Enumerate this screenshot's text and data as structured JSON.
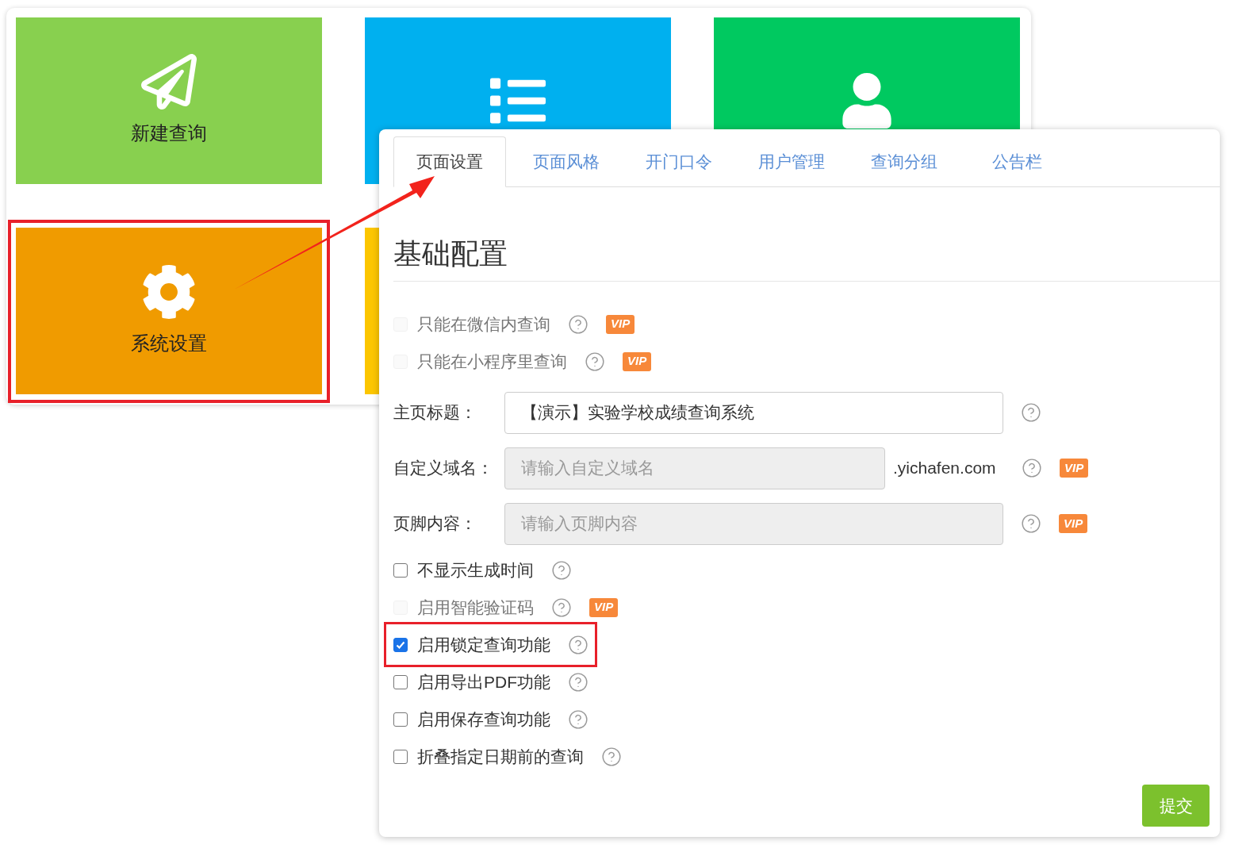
{
  "dashboard": {
    "tiles": [
      {
        "label": "新建查询",
        "color": "#88d04f",
        "highlighted": false
      },
      {
        "color": "#00b0ef",
        "highlighted": false
      },
      {
        "color": "#00c960",
        "highlighted": false
      },
      {
        "label": "系统设置",
        "color": "#f09b00",
        "highlighted": true
      },
      {
        "color": "#fcc600",
        "highlighted": false
      }
    ]
  },
  "settings": {
    "tabs": [
      {
        "label": "页面设置",
        "selected": true
      },
      {
        "label": "页面风格",
        "selected": false
      },
      {
        "label": "开门口令",
        "selected": false
      },
      {
        "label": "用户管理",
        "selected": false
      },
      {
        "label": "查询分组",
        "selected": false
      },
      {
        "label": "公告栏",
        "selected": false
      }
    ],
    "heading": "基础配置",
    "rows": [
      {
        "kind": "checkbox",
        "label": "只能在微信内查询",
        "checked": false,
        "disabled": true,
        "badge": "VIP",
        "highlighted": false
      },
      {
        "kind": "checkbox",
        "label": "只能在小程序里查询",
        "checked": false,
        "disabled": true,
        "badge": "VIP",
        "highlighted": false
      },
      {
        "kind": "field",
        "label": "主页标题：",
        "value": "【演示】实验学校成绩查询系统",
        "disabled": false
      },
      {
        "kind": "field",
        "label": "自定义域名：",
        "placeholder": "请输入自定义域名",
        "suffix": ".yichafen.com",
        "disabled": true,
        "badge": "VIP"
      },
      {
        "kind": "field",
        "label": "页脚内容：",
        "placeholder": "请输入页脚内容",
        "disabled": true,
        "badge": "VIP"
      },
      {
        "kind": "checkbox",
        "label": "不显示生成时间",
        "checked": false,
        "disabled": false,
        "highlighted": false
      },
      {
        "kind": "checkbox",
        "label": "启用智能验证码",
        "checked": false,
        "disabled": true,
        "badge": "VIP",
        "highlighted": false
      },
      {
        "kind": "checkbox",
        "label": "启用锁定查询功能",
        "checked": true,
        "disabled": false,
        "highlighted": true
      },
      {
        "kind": "checkbox",
        "label": "启用导出PDF功能",
        "checked": false,
        "disabled": false,
        "highlighted": false
      },
      {
        "kind": "checkbox",
        "label": "启用保存查询功能",
        "checked": false,
        "disabled": false,
        "highlighted": false
      },
      {
        "kind": "checkbox",
        "label": "折叠指定日期前的查询",
        "checked": false,
        "disabled": false,
        "highlighted": false
      }
    ],
    "submit": "提交"
  }
}
